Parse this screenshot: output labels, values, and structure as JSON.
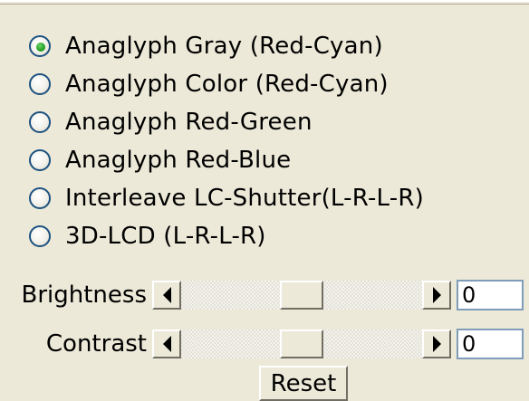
{
  "stereo_modes": {
    "options": [
      {
        "label": "Anaglyph Gray (Red-Cyan)",
        "checked": true
      },
      {
        "label": "Anaglyph Color (Red-Cyan)",
        "checked": false
      },
      {
        "label": "Anaglyph Red-Green",
        "checked": false
      },
      {
        "label": "Anaglyph Red-Blue",
        "checked": false
      },
      {
        "label": "Interleave LC-Shutter(L-R-L-R)",
        "checked": false
      },
      {
        "label": "3D-LCD (L-R-L-R)",
        "checked": false
      }
    ]
  },
  "brightness": {
    "label": "Brightness",
    "value": "0",
    "slider_position": 0.5
  },
  "contrast": {
    "label": "Contrast",
    "value": "0",
    "slider_position": 0.5
  },
  "reset_label": "Reset"
}
